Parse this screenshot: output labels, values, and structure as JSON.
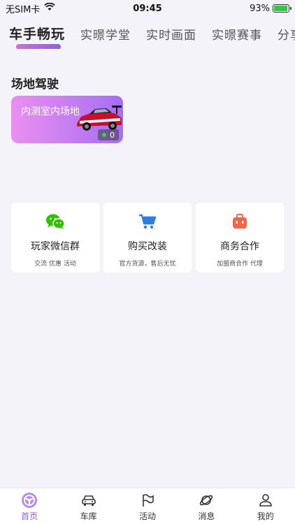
{
  "status_bar": {
    "carrier": "无SIM卡",
    "time": "09:45",
    "battery": "93%",
    "battery_level": 0.93
  },
  "tabs": [
    {
      "label": "车手畅玩",
      "active": true
    },
    {
      "label": "实暻学堂",
      "active": false
    },
    {
      "label": "实时画面",
      "active": false
    },
    {
      "label": "实暻赛事",
      "active": false
    },
    {
      "label": "分享车辆",
      "active": false
    }
  ],
  "section": {
    "title": "场地驾驶",
    "venue": {
      "name": "内测室内场地",
      "online_count": "0",
      "colors": {
        "start": "#ea8ff0",
        "end": "#a56ef3"
      }
    }
  },
  "services": [
    {
      "title": "玩家微信群",
      "subtitle": "交流 优惠 活动",
      "icon": "wechat-icon",
      "color": "#2dc100"
    },
    {
      "title": "购买改装",
      "subtitle": "官方货源，售后无忧",
      "icon": "cart-icon",
      "color": "#2f7de1"
    },
    {
      "title": "商务合作",
      "subtitle": "加盟商合作 代理",
      "icon": "briefcase-icon",
      "color": "#f4664a"
    }
  ],
  "bottom_nav": [
    {
      "label": "首页",
      "icon": "home-wheel-icon",
      "active": true
    },
    {
      "label": "车库",
      "icon": "car-icon",
      "active": false
    },
    {
      "label": "活动",
      "icon": "flag-icon",
      "active": false
    },
    {
      "label": "消息",
      "icon": "planet-icon",
      "active": false
    },
    {
      "label": "我的",
      "icon": "user-icon",
      "active": false
    }
  ],
  "accent_color": "#8f5ee8"
}
